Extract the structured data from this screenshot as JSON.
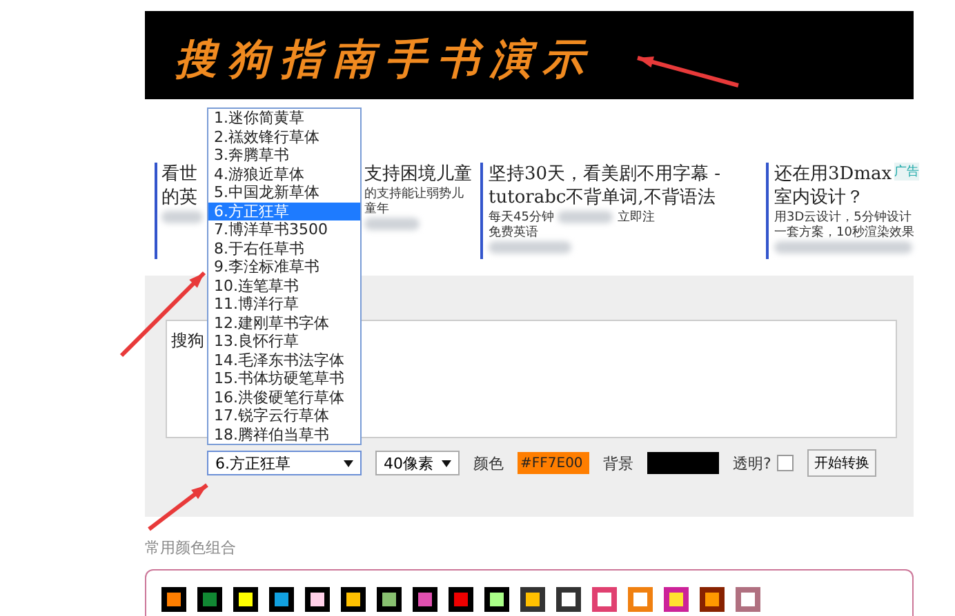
{
  "banner": {
    "text": "搜狗指南手书演示"
  },
  "ads": [
    {
      "title": [
        "看世",
        "的英"
      ]
    },
    {
      "title": [
        "支持困境儿童"
      ],
      "lines": [
        [
          "的支持能让弱势儿"
        ],
        [
          "童年"
        ]
      ]
    },
    {
      "title": [
        "坚持30天，看美剧不用字幕 -",
        "tutorabc不背单词,不背语法"
      ],
      "lines": [
        [
          "每天45分钟",
          "立即注"
        ],
        [
          "免费英语"
        ]
      ]
    },
    {
      "title": [
        "还在用3Dmax",
        "室内设计？"
      ],
      "lines": [
        [
          "用3D云设计，5分钟设计"
        ],
        [
          "一套方案，10秒渲染效果"
        ]
      ],
      "badge": "广告"
    }
  ],
  "form": {
    "text_input": {
      "value": "搜狗"
    },
    "font_select": {
      "value": "6.方正狂草",
      "expanded": true,
      "options": [
        {
          "label": "1.迷你简黄草",
          "selected": false
        },
        {
          "label": "2.禚效锋行草体",
          "selected": false
        },
        {
          "label": "3.奔腾草书",
          "selected": false
        },
        {
          "label": "4.游狼近草体",
          "selected": false
        },
        {
          "label": "5.中国龙新草体",
          "selected": false
        },
        {
          "label": "6.方正狂草",
          "selected": true
        },
        {
          "label": "7.博洋草书3500",
          "selected": false
        },
        {
          "label": "8.于右任草书",
          "selected": false
        },
        {
          "label": "9.李洤标准草书",
          "selected": false
        },
        {
          "label": "10.连笔草书",
          "selected": false
        },
        {
          "label": "11.博洋行草",
          "selected": false
        },
        {
          "label": "12.建刚草书字体",
          "selected": false
        },
        {
          "label": "13.良怀行草",
          "selected": false
        },
        {
          "label": "14.毛泽东书法字体",
          "selected": false
        },
        {
          "label": "15.书体坊硬笔草书",
          "selected": false
        },
        {
          "label": "16.洪俊硬笔行草体",
          "selected": false
        },
        {
          "label": "17.锐字云行草体",
          "selected": false
        },
        {
          "label": "18.腾祥伯当草书",
          "selected": false
        }
      ]
    },
    "size_select": {
      "value": "40像素"
    },
    "text_color": {
      "label": "颜色",
      "value": "#FF7E00",
      "color": "#ff7e00"
    },
    "background": {
      "label": "背景",
      "color": "#000000"
    },
    "transparent": {
      "label": "透明?",
      "checked": false
    },
    "submit": "开始转换"
  },
  "presets": {
    "title": "常用颜色组合",
    "swatches": [
      {
        "frame": {
          "color": "#000000"
        },
        "color": "#ff7e00"
      },
      {
        "frame": {
          "color": "#000000"
        },
        "color": "#118833"
      },
      {
        "frame": {
          "color": "#000000"
        },
        "color": "#ffff00"
      },
      {
        "frame": {
          "color": "#000000"
        },
        "color": "#11a0e0"
      },
      {
        "frame": {
          "color": "#000000"
        },
        "color": "#ffd0e8"
      },
      {
        "frame": {
          "color": "#000000"
        },
        "color": "#ffc000"
      },
      {
        "frame": {
          "color": "#000000"
        },
        "color": "#88c070"
      },
      {
        "frame": {
          "color": "#000000"
        },
        "color": "#e050b0"
      },
      {
        "frame": {
          "color": "#000000"
        },
        "color": "#ee0000"
      },
      {
        "frame": {
          "color": "#000000"
        },
        "color": "#aaff88"
      },
      {
        "frame": {
          "color": "#333333"
        },
        "color": "#ffc000"
      },
      {
        "frame": {
          "color": "#333333"
        },
        "color": "#ffffff"
      },
      {
        "frame": {
          "color": "#e04070"
        },
        "color": "#ffffff"
      },
      {
        "frame": {
          "color": "#f08010"
        },
        "color": "#ffffff"
      },
      {
        "frame": {
          "color": "#cc2299"
        },
        "color": "#ffe030"
      },
      {
        "frame": {
          "color": "#882200"
        },
        "color": "#ff9900"
      },
      {
        "frame": {
          "color": "#b07080"
        },
        "color": "#ffffff"
      }
    ]
  }
}
